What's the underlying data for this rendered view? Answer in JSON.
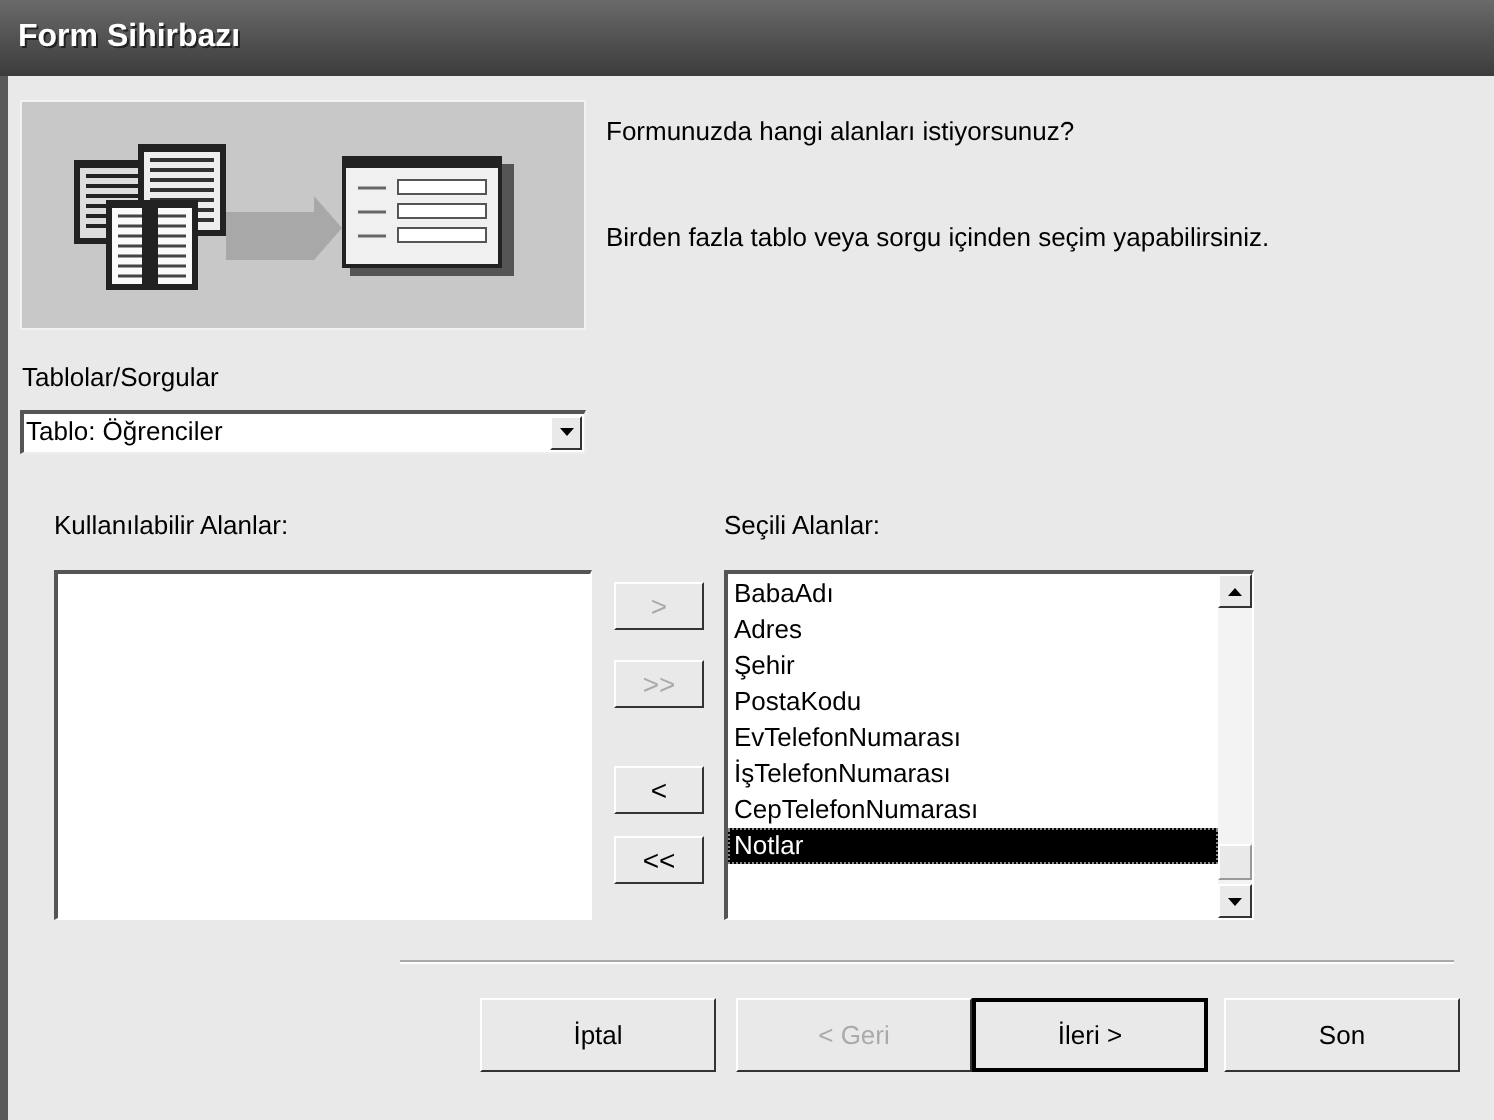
{
  "window": {
    "title": "Form Sihirbazı"
  },
  "intro": [
    "Formunuzda hangi alanları istiyorsunuz?",
    "Birden fazla tablo veya sorgu içinden seçim yapabilirsiniz."
  ],
  "source": {
    "label": "Tablolar/Sorgular",
    "value": "Tablo: Öğrenciler"
  },
  "available": {
    "label": "Kullanılabilir Alanlar:"
  },
  "move_buttons": [
    {
      "label": ">",
      "disabled": true
    },
    {
      "label": ">>",
      "disabled": true
    },
    {
      "label": "<",
      "disabled": false
    },
    {
      "label": "<<",
      "disabled": false
    }
  ],
  "selected_fields": {
    "label": "Seçili Alanlar:",
    "items": [
      {
        "label": "BabaAdı",
        "selected": false
      },
      {
        "label": "Adres",
        "selected": false
      },
      {
        "label": "Şehir",
        "selected": false
      },
      {
        "label": "PostaKodu",
        "selected": false
      },
      {
        "label": "EvTelefonNumarası",
        "selected": false
      },
      {
        "label": "İşTelefonNumarası",
        "selected": false
      },
      {
        "label": "CepTelefonNumarası",
        "selected": false
      },
      {
        "label": "Notlar",
        "selected": true
      }
    ]
  },
  "buttons": [
    {
      "label": "İptal",
      "disabled": false,
      "default": false
    },
    {
      "label": "< Geri",
      "disabled": true,
      "default": false
    },
    {
      "label": "İleri >",
      "disabled": false,
      "default": true
    },
    {
      "label": "Son",
      "disabled": false,
      "default": false
    }
  ]
}
